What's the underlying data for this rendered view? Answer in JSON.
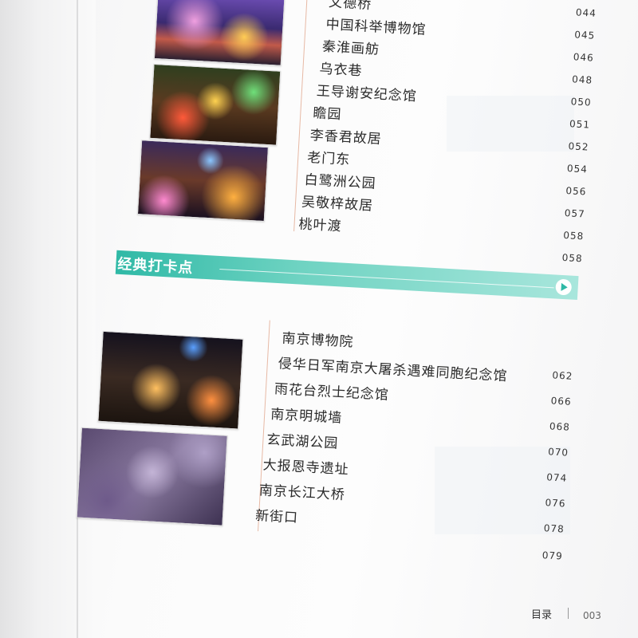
{
  "section1": {
    "items": [
      {
        "name": "文德桥",
        "page": "044"
      },
      {
        "name": "中国科举博物馆",
        "page": "045"
      },
      {
        "name": "秦淮画舫",
        "page": "046"
      },
      {
        "name": "乌衣巷",
        "page": "048"
      },
      {
        "name": "王导谢安纪念馆",
        "page": "050"
      },
      {
        "name": "瞻园",
        "page": "051"
      },
      {
        "name": "李香君故居",
        "page": "052"
      },
      {
        "name": "老门东",
        "page": "054"
      },
      {
        "name": "白鹭洲公园",
        "page": "056"
      },
      {
        "name": "吴敬梓故居",
        "page": "057"
      },
      {
        "name": "桃叶渡",
        "page": "058"
      },
      {
        "name": "",
        "page": "058"
      }
    ]
  },
  "section2": {
    "title": "经典打卡点",
    "items": [
      {
        "name": "南京博物院",
        "page": ""
      },
      {
        "name": "侵华日军南京大屠杀遇难同胞纪念馆",
        "page": "062"
      },
      {
        "name": "雨花台烈士纪念馆",
        "page": "066"
      },
      {
        "name": "南京明城墙",
        "page": "068"
      },
      {
        "name": "玄武湖公园",
        "page": "070"
      },
      {
        "name": "大报恩寺遗址",
        "page": "074"
      },
      {
        "name": "南京长江大桥",
        "page": "076"
      },
      {
        "name": "新街口",
        "page": "078"
      },
      {
        "name": "",
        "page": "079"
      }
    ]
  },
  "footer": {
    "title": "目录",
    "page": "003"
  }
}
